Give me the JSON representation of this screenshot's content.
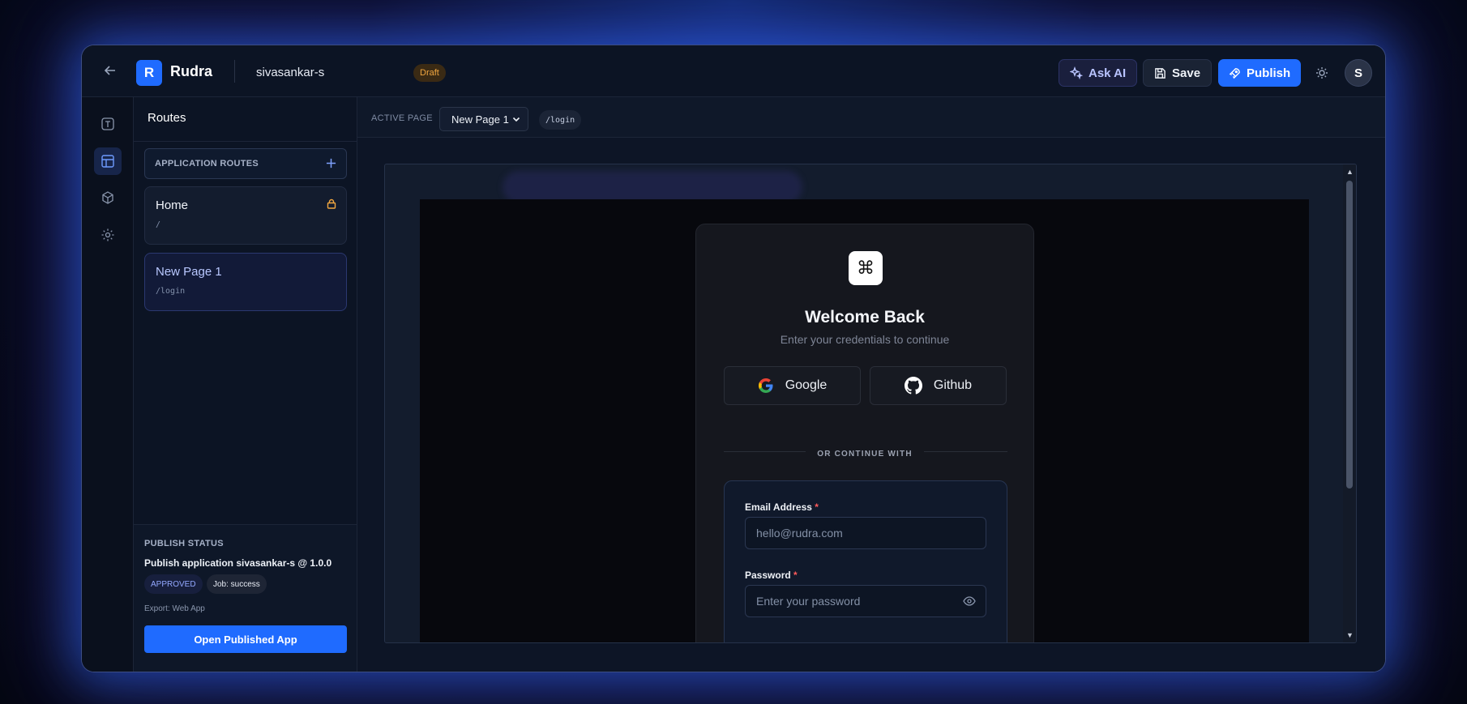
{
  "header": {
    "brand_letter": "R",
    "brand_name": "Rudra",
    "project_name": "sivasankar-s",
    "status_badge": "Draft",
    "ask_ai_label": "Ask AI",
    "save_label": "Save",
    "publish_label": "Publish",
    "avatar_initial": "S"
  },
  "rail": {
    "items": [
      {
        "icon": "text-icon",
        "active": false
      },
      {
        "icon": "layout-icon",
        "active": true
      },
      {
        "icon": "cube-icon",
        "active": false
      },
      {
        "icon": "gear-icon",
        "active": false
      }
    ]
  },
  "routes_panel": {
    "title": "Routes",
    "section_label": "APPLICATION ROUTES",
    "routes": [
      {
        "name": "Home",
        "path": "/",
        "locked": true
      },
      {
        "name": "New Page 1",
        "path": "/login",
        "locked": false
      }
    ]
  },
  "publish_status": {
    "heading": "PUBLISH STATUS",
    "description": "Publish application sivasankar-s @ 1.0.0",
    "approval_badge": "APPROVED",
    "job_badge": "Job: success",
    "export": "Export: Web App",
    "open_button": "Open Published App"
  },
  "page_bar": {
    "label": "ACTIVE PAGE",
    "selected_page": "New Page 1",
    "path": "/login"
  },
  "preview": {
    "title": "Welcome Back",
    "subtitle": "Enter your credentials to continue",
    "google_label": "Google",
    "github_label": "Github",
    "divider": "OR CONTINUE WITH",
    "email_label": "Email Address",
    "email_placeholder": "hello@rudra.com",
    "password_label": "Password",
    "password_placeholder": "Enter your password",
    "required_mark": "*"
  },
  "colors": {
    "accent": "#1f6bff",
    "draft": "#f0a640",
    "approved": "#93a8ff",
    "required": "#ff5b5b"
  }
}
